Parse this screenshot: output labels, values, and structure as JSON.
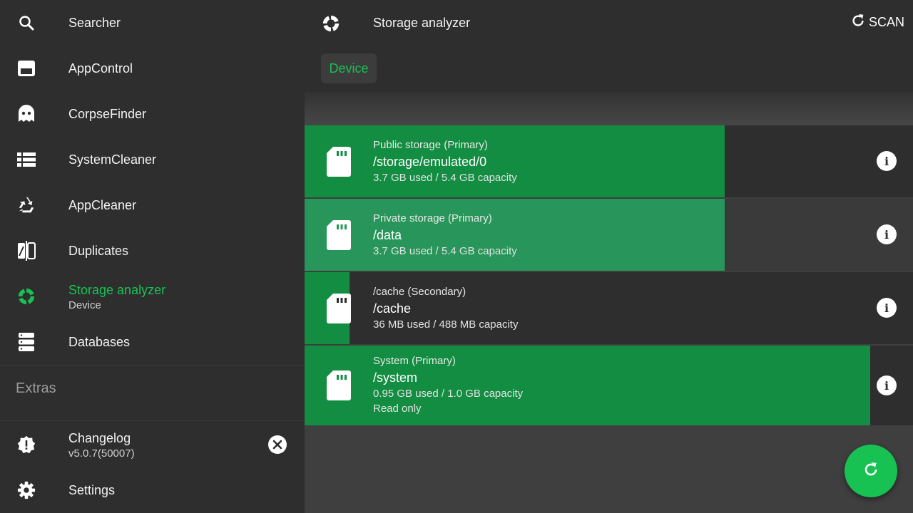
{
  "sidebar": {
    "items": [
      {
        "label": "Searcher",
        "icon": "search-icon"
      },
      {
        "label": "AppControl",
        "icon": "app-window-icon"
      },
      {
        "label": "CorpseFinder",
        "icon": "ghost-icon"
      },
      {
        "label": "SystemCleaner",
        "icon": "list-icon"
      },
      {
        "label": "AppCleaner",
        "icon": "recycle-icon"
      },
      {
        "label": "Duplicates",
        "icon": "compare-icon"
      },
      {
        "label": "Storage analyzer",
        "sublabel": "Device",
        "icon": "pie-chart-icon",
        "active": true
      },
      {
        "label": "Databases",
        "icon": "database-icon"
      }
    ],
    "extras_heading": "Extras",
    "changelog": {
      "label": "Changelog",
      "version": "v5.0.7(50007)",
      "icon": "alert-badge-icon"
    },
    "settings": {
      "label": "Settings",
      "icon": "gear-icon"
    }
  },
  "header": {
    "title": "Storage analyzer",
    "scan_label": "SCAN",
    "tab_label": "Device"
  },
  "colors": {
    "accent": "#17c253",
    "fill_primary": "#138d42",
    "fill_highlighted": "#28965a",
    "surface": "#2e2e2e",
    "background": "#3f3f3f"
  },
  "storages": [
    {
      "label": "Public storage (Primary)",
      "path": "/storage/emulated/0",
      "usage": "3.7 GB used / 5.4 GB capacity",
      "extra": "",
      "used_fraction": 0.69
    },
    {
      "label": "Private storage (Primary)",
      "path": "/data",
      "usage": "3.7 GB used / 5.4 GB capacity",
      "extra": "",
      "used_fraction": 0.69,
      "highlighted": true
    },
    {
      "label": "/cache (Secondary)",
      "path": "/cache",
      "usage": "36 MB used / 488 MB capacity",
      "extra": "",
      "used_fraction": 0.074
    },
    {
      "label": "System (Primary)",
      "path": "/system",
      "usage": "0.95 GB used / 1.0 GB capacity",
      "extra": "Read only",
      "used_fraction": 0.93
    }
  ]
}
